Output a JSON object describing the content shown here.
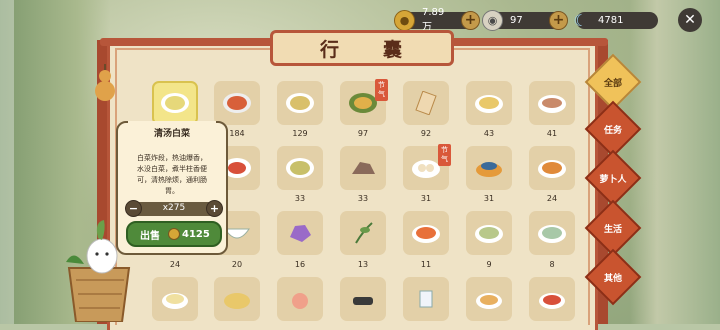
{
  "resources": [
    {
      "name": "coins",
      "value": "7.89万",
      "icon": "coin-icon"
    },
    {
      "name": "pearls",
      "value": "97",
      "icon": "pearl-icon"
    },
    {
      "name": "moon",
      "value": "4781",
      "icon": "moon-icon"
    }
  ],
  "title": {
    "char1": "行",
    "char2": "囊"
  },
  "tooltip": {
    "name": "清汤白菜",
    "desc_lines": [
      "白菜炸段，热油爆香，",
      "水没白菜，煮半柱香便",
      "可，清热除烦，通利肠",
      "胃。"
    ],
    "qty": "x275",
    "sell_label": "出售",
    "price": "4125"
  },
  "tabs": [
    {
      "label": "全部",
      "active": true
    },
    {
      "label": "任务",
      "active": false
    },
    {
      "label": "萝卜人",
      "active": false
    },
    {
      "label": "生活",
      "active": false
    },
    {
      "label": "其他",
      "active": false
    }
  ],
  "festival_tag": "节气",
  "counts": [
    [
      "",
      "184",
      "129",
      "97",
      "92",
      "43",
      "41"
    ],
    [
      "",
      "",
      "33",
      "33",
      "31",
      "31",
      "24"
    ],
    [
      "24",
      "20",
      "16",
      "13",
      "11",
      "9",
      "8"
    ]
  ],
  "colors": {
    "frame": "#b7563a",
    "sell": "#4f8a3a",
    "tab": "#c9542f",
    "tab_active": "#f0c25a"
  }
}
